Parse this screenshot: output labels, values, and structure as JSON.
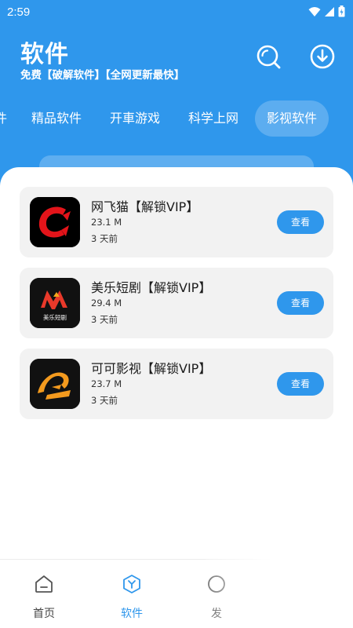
{
  "status_bar": {
    "time": "2:59"
  },
  "header": {
    "title": "软件",
    "subtitle": "免费【破解软件】【全网更新最快】",
    "search_icon": "search-icon",
    "download_icon": "download-icon"
  },
  "tabs": [
    {
      "label": "件"
    },
    {
      "label": "精品软件"
    },
    {
      "label": "开車游戏"
    },
    {
      "label": "科学上网"
    },
    {
      "label": "影视软件",
      "active": true
    }
  ],
  "apps": [
    {
      "name": "网飞猫【解锁VIP】",
      "size": "23.1 M",
      "time": "3 天前",
      "button": "查看",
      "icon_text": ""
    },
    {
      "name": "美乐短剧【解锁VIP】",
      "size": "29.4 M",
      "time": "3 天前",
      "button": "查看",
      "icon_text": "美乐短剧"
    },
    {
      "name": "可可影视【解锁VIP】",
      "size": "23.7 M",
      "time": "3 天前",
      "button": "查看",
      "icon_text": ""
    }
  ],
  "bottom_nav": [
    {
      "label": "首页",
      "icon": "home-icon"
    },
    {
      "label": "软件",
      "icon": "software-icon",
      "active": true
    },
    {
      "label": "发",
      "icon": "discover-icon"
    }
  ],
  "colors": {
    "primary": "#2f97ec",
    "card_bg": "#f2f2f2"
  }
}
